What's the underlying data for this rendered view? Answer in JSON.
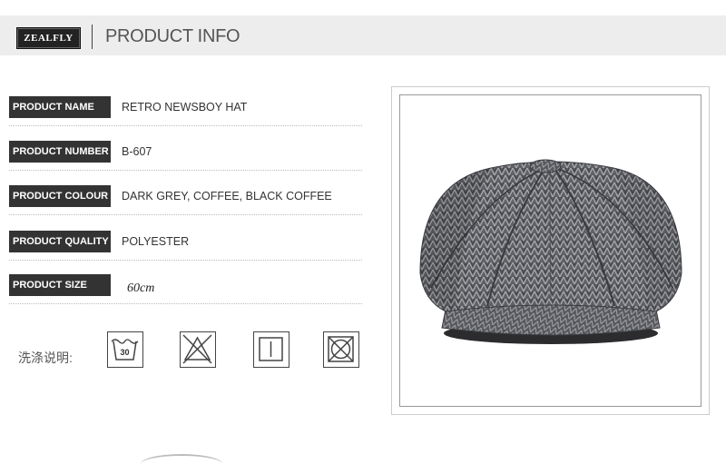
{
  "header": {
    "brand": "ZEALFLY",
    "title": "PRODUCT INFO"
  },
  "specs": [
    {
      "label": "PRODUCT NAME",
      "value": "RETRO NEWSBOY HAT"
    },
    {
      "label": "PRODUCT NUMBER",
      "value": "B-607"
    },
    {
      "label": "PRODUCT COLOUR",
      "value": "DARK GREY, COFFEE, BLACK COFFEE"
    },
    {
      "label": "PRODUCT QUALITY",
      "value": "POLYESTER"
    },
    {
      "label": "PRODUCT SIZE",
      "value": "60cm"
    }
  ],
  "care": {
    "label": "洗涤说明:",
    "wash_temp": "30",
    "icons": [
      "wash-30-icon",
      "no-bleach-icon",
      "line-dry-icon",
      "no-tumble-dry-icon"
    ]
  },
  "product_image": {
    "icon": "newsboy-cap-image",
    "colors": {
      "main": "#5f6166",
      "dark": "#3a3b3f",
      "light": "#a9abae"
    }
  }
}
